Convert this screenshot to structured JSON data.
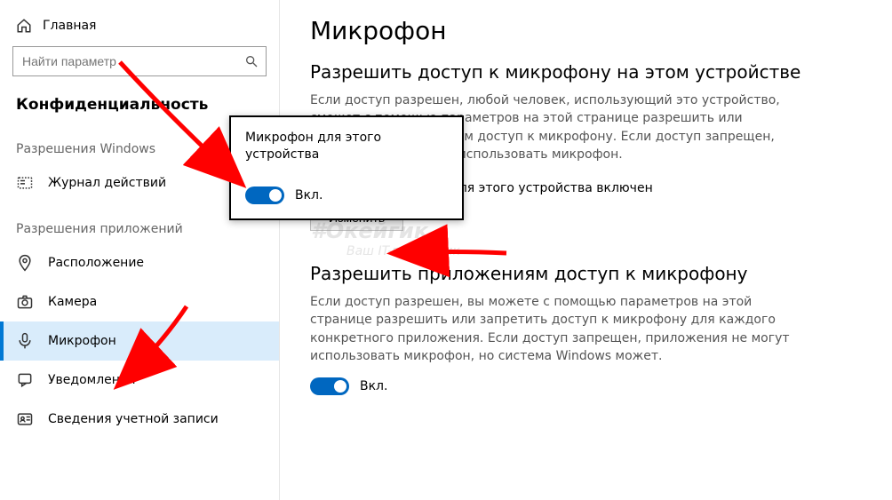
{
  "sidebar": {
    "home_label": "Главная",
    "search_placeholder": "Найти параметр",
    "category_title": "Конфиденциальность",
    "section_windows_caption": "Разрешения Windows",
    "section_apps_caption": "Разрешения приложений",
    "items_windows": [
      {
        "label": "Журнал действий",
        "icon": "activity-icon"
      }
    ],
    "items_apps": [
      {
        "label": "Расположение",
        "icon": "location-icon"
      },
      {
        "label": "Камера",
        "icon": "camera-icon"
      },
      {
        "label": "Микрофон",
        "icon": "microphone-icon",
        "selected": true
      },
      {
        "label": "Уведомления",
        "icon": "notifications-icon"
      },
      {
        "label": "Сведения учетной записи",
        "icon": "account-info-icon"
      }
    ]
  },
  "main": {
    "title": "Микрофон",
    "section1": {
      "heading": "Разрешить доступ к микрофону на этом устройстве",
      "description": "Если доступ разрешен, любой человек, использующий это устройство, сможет с помощью параметров на этой странице разрешить или запретить приложениям доступ к микрофону. Если доступ запрещен, приложения не могут использовать микрофон.",
      "status_text": "Доступ к микрофону для этого устройства включен",
      "change_button": "Изменить"
    },
    "section2": {
      "heading": "Разрешить приложениям доступ к микрофону",
      "description": "Если доступ разрешен, вы можете с помощью параметров на этой странице разрешить или запретить доступ к микрофону для каждого конкретного приложения. Если доступ запрещен, приложения не могут использовать микрофон, но система Windows может.",
      "toggle_state": true,
      "toggle_label": "Вкл."
    }
  },
  "popup": {
    "title": "Микрофон для этого устройства",
    "toggle_state": true,
    "toggle_label": "Вкл."
  },
  "watermark": {
    "primary": "#Окейгик",
    "secondary": "Ваш IT-помощник"
  },
  "colors": {
    "accent": "#0067c0",
    "sidebar_selected_bg": "#d9ecfb",
    "arrow": "#ff0000"
  }
}
